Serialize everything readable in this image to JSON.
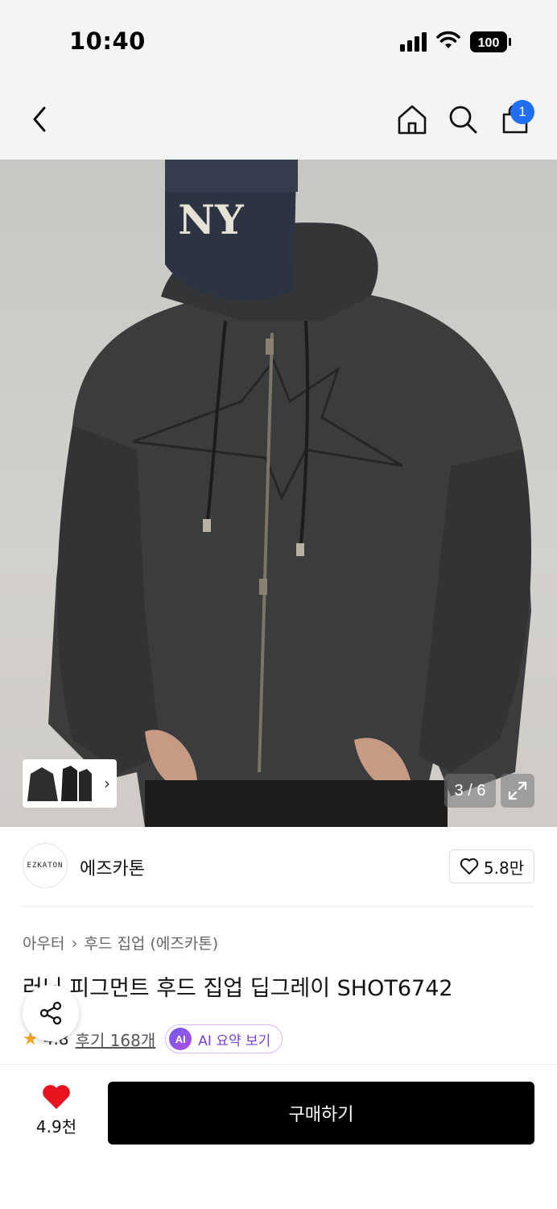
{
  "status_bar": {
    "time": "10:40",
    "battery": "100"
  },
  "nav": {
    "cart_count": "1"
  },
  "gallery": {
    "counter": "3 / 6"
  },
  "brand": {
    "logo_text": "EZKATON",
    "name": "에즈카톤",
    "likes": "5.8만"
  },
  "breadcrumb": {
    "category": "아우터",
    "subcategory": "후드 집업 (에즈카톤)"
  },
  "product": {
    "title": "러닝 피그먼트 후드 집업 딥그레이 SHOT6742",
    "rating": "4.8",
    "reviews": "후기 168개",
    "ai_badge": "AI",
    "ai_label": "AI 요약 보기"
  },
  "bottom": {
    "wish_count": "4.9천",
    "buy_label": "구매하기"
  },
  "colors": {
    "accent_blue": "#1f6ff0",
    "heart_red": "#e8131f",
    "ai_purple": "#7a3fd6"
  }
}
